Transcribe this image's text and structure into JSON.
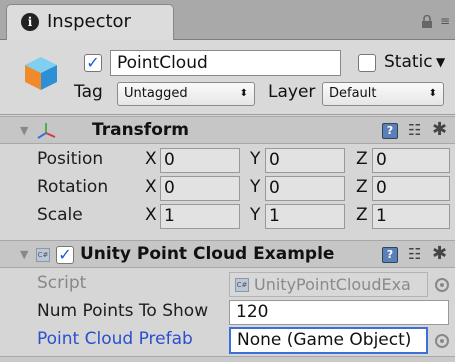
{
  "tab": {
    "title": "Inspector",
    "info_glyph": "i",
    "tools_glyph": "≡"
  },
  "game_object": {
    "active": true,
    "name": "PointCloud",
    "static_label": "Static",
    "tag_label": "Tag",
    "tag_value": "Untagged",
    "layer_label": "Layer",
    "layer_value": "Default"
  },
  "transform": {
    "title": "Transform",
    "rows": [
      {
        "label": "Position",
        "x": "0",
        "y": "0",
        "z": "0"
      },
      {
        "label": "Rotation",
        "x": "0",
        "y": "0",
        "z": "0"
      },
      {
        "label": "Scale",
        "x": "1",
        "y": "1",
        "z": "1"
      }
    ],
    "axis_labels": {
      "x": "X",
      "y": "Y",
      "z": "Z"
    }
  },
  "component": {
    "enabled": true,
    "title": "Unity Point Cloud Example",
    "cs_badge": "C#",
    "script_label": "Script",
    "script_value": "UnityPointCloudExa",
    "num_points_label": "Num Points To Show",
    "num_points_value": "120",
    "prefab_label": "Point Cloud Prefab",
    "prefab_value": "None (Game Object)"
  },
  "colors": {
    "accent": "#2a4fd0",
    "field_focus": "#3d6fd6",
    "panel": "#d6d6d6"
  },
  "icons": [
    "info-icon",
    "lock-icon",
    "menu-icon",
    "cube-icon",
    "transform-axis-icon",
    "help-book-icon",
    "preset-icon",
    "gear-icon",
    "cs-script-icon",
    "object-picker-icon"
  ]
}
